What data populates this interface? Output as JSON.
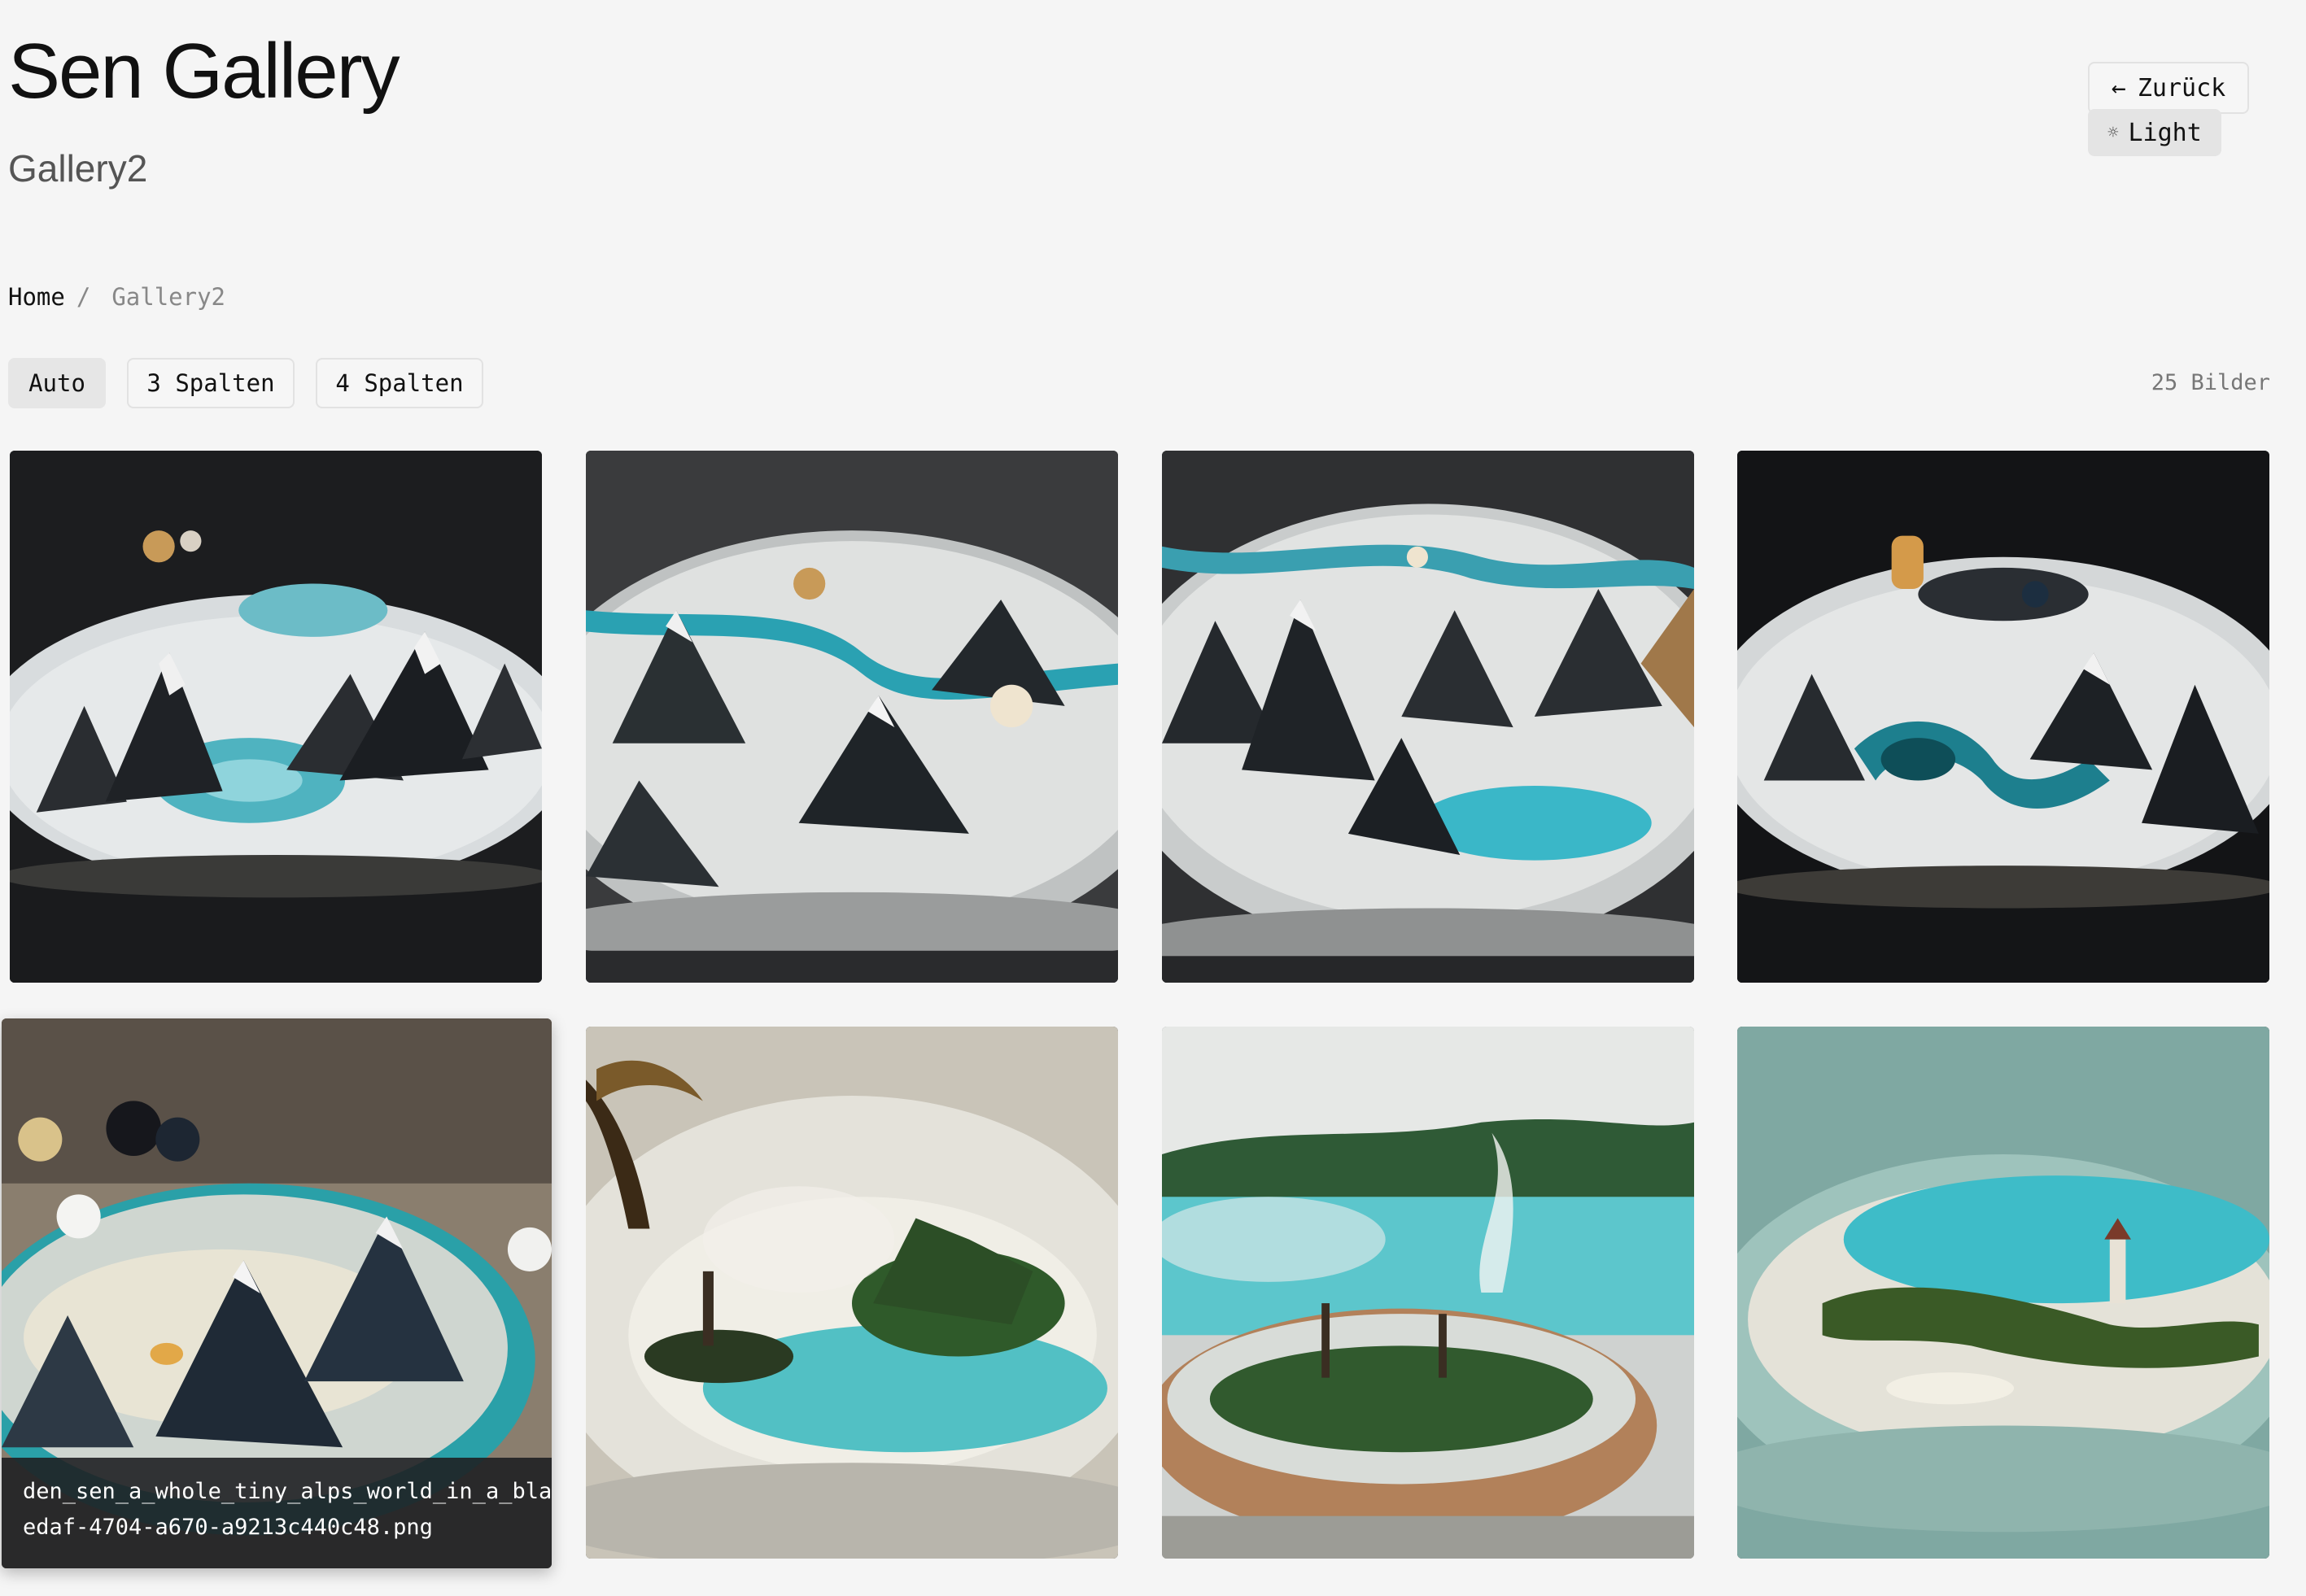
{
  "header": {
    "title": "Sen Gallery",
    "subtitle": "Gallery2",
    "back_label": "Zurück",
    "back_icon": "←",
    "light_label": "Light",
    "light_icon": "☼"
  },
  "breadcrumb": {
    "home": "Home",
    "separator": "/",
    "current": "Gallery2"
  },
  "toolbar": {
    "layout_options": [
      "Auto",
      "3 Spalten",
      "4 Spalten"
    ],
    "active": "Auto",
    "count_label": "25 Bilder"
  },
  "gallery": {
    "caption_line1": "den_sen_a_whole_tiny_alps_world_in_a_bla",
    "caption_line2": "edaf-4704-a670-a9213c440c48.png",
    "images": [
      {
        "scene": "alps-dark"
      },
      {
        "scene": "alps-light"
      },
      {
        "scene": "alps-light"
      },
      {
        "scene": "alps-dark"
      },
      {
        "scene": "alps-crystals"
      },
      {
        "scene": "island-palm"
      },
      {
        "scene": "island-steam"
      },
      {
        "scene": "island-lighthouse"
      }
    ]
  },
  "colors": {
    "background": "#f5f5f5",
    "text": "#111111",
    "muted": "#888888",
    "teal": "#2fb3bf"
  }
}
